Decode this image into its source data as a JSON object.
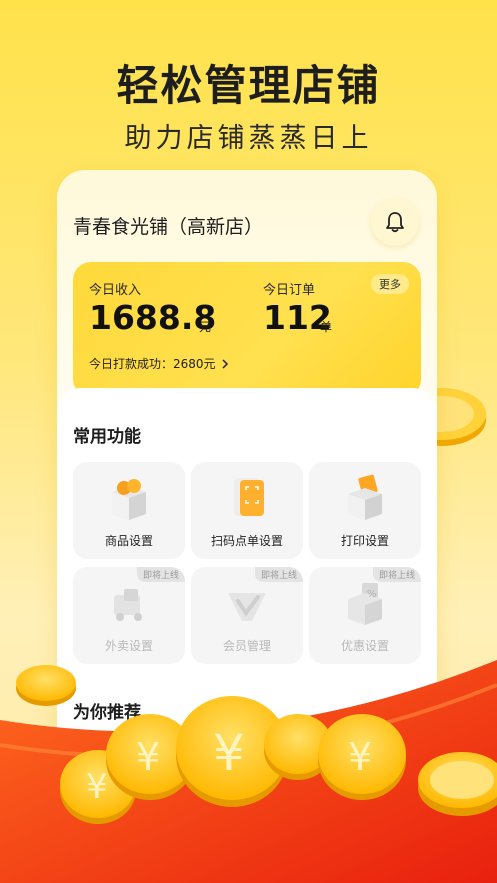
{
  "headline": "轻松管理店铺",
  "subline": "助力店铺蒸蒸日上",
  "store": {
    "name": "青春食光铺（高新店）",
    "bell_icon": "bell-icon"
  },
  "stats": {
    "income_label": "今日收入",
    "income_value": "1688.8",
    "income_unit": "元",
    "orders_label": "今日订单",
    "orders_value": "112",
    "orders_unit": "单",
    "more_label": "更多",
    "payout_text": "今日打款成功：2680元"
  },
  "functions": {
    "title": "常用功能",
    "items": [
      {
        "label": "商品设置",
        "icon": "product-box-icon",
        "status": ""
      },
      {
        "label": "扫码点单设置",
        "icon": "scan-order-icon",
        "status": ""
      },
      {
        "label": "打印设置",
        "icon": "printer-box-icon",
        "status": ""
      },
      {
        "label": "外卖设置",
        "icon": "delivery-icon",
        "status": "即将上线"
      },
      {
        "label": "会员管理",
        "icon": "member-icon",
        "status": "即将上线"
      },
      {
        "label": "优惠设置",
        "icon": "discount-icon",
        "status": "即将上线"
      }
    ]
  },
  "recommend": {
    "title": "为你推荐"
  },
  "colors": {
    "brand_yellow": "#FFD93A",
    "red": "#F23A1C",
    "coin": "#FFC61A"
  }
}
